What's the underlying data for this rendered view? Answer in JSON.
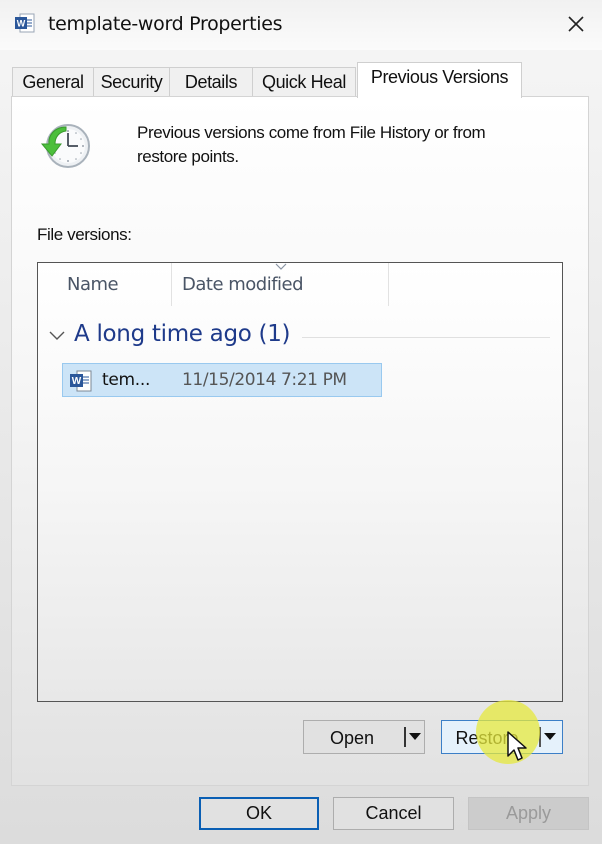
{
  "window": {
    "title": "template-word Properties",
    "icon": "word-document-icon",
    "close_icon": "close-icon"
  },
  "tabs": [
    {
      "label": "General",
      "active": false
    },
    {
      "label": "Security",
      "active": false
    },
    {
      "label": "Details",
      "active": false
    },
    {
      "label": "Quick Heal",
      "active": false
    },
    {
      "label": "Previous Versions",
      "active": true
    }
  ],
  "previous_versions": {
    "description": "Previous versions come from File History or from restore points.",
    "description_icon": "restore-clock-icon",
    "file_versions_label": "File versions:",
    "columns": [
      "Name",
      "Date modified"
    ],
    "sorted_column": "Date modified",
    "groups": [
      {
        "title": "A long time ago (1)",
        "expanded": true,
        "items": [
          {
            "name": "tem...",
            "date_modified": "11/15/2014 7:21 PM",
            "selected": true,
            "icon": "word-document-icon"
          }
        ]
      }
    ],
    "open_button": "Open",
    "restore_button": "Restore"
  },
  "footer": {
    "ok": "OK",
    "cancel": "Cancel",
    "apply": "Apply"
  },
  "colors": {
    "selection_bg": "#cce4f7",
    "selection_border": "#99c9ef",
    "group_title": "#1e3a8a",
    "default_button_border": "#0a5fb4",
    "cursor_highlight": "#e6e83c"
  }
}
